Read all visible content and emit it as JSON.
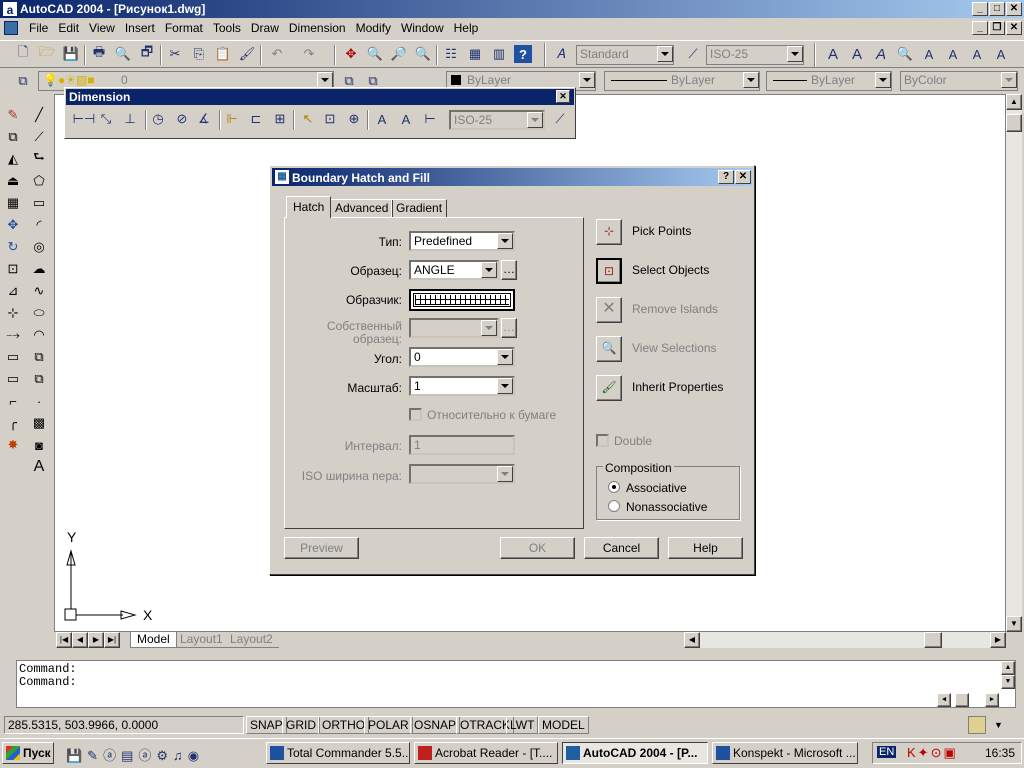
{
  "app": {
    "title": "AutoCAD 2004 - [Рисунок1.dwg]"
  },
  "menu": [
    "File",
    "Edit",
    "View",
    "Insert",
    "Format",
    "Tools",
    "Draw",
    "Dimension",
    "Modify",
    "Window",
    "Help"
  ],
  "toolbar": {
    "text_style": "Standard",
    "dim_style": "ISO-25"
  },
  "layers": {
    "current_layer": "0",
    "color": "ByLayer",
    "linetype": "ByLayer",
    "lineweight": "ByLayer",
    "plotstyle": "ByColor"
  },
  "dimension_toolbar": {
    "title": "Dimension",
    "style": "ISO-25"
  },
  "axes": {
    "y": "Y",
    "x": "X"
  },
  "layout_tabs": [
    "Model",
    "Layout1",
    "Layout2"
  ],
  "command": {
    "lines": [
      "Command:",
      "Command:"
    ]
  },
  "status": {
    "coords": "285.5315, 503.9966, 0.0000",
    "buttons": [
      "SNAP",
      "GRID",
      "ORTHO",
      "POLAR",
      "OSNAP",
      "OTRACK",
      "LWT",
      "MODEL"
    ]
  },
  "dialog": {
    "title": "Boundary Hatch and Fill",
    "tabs": [
      "Hatch",
      "Advanced",
      "Gradient"
    ],
    "fields": {
      "type_label": "Тип:",
      "type_value": "Predefined",
      "pattern_label": "Образец:",
      "pattern_value": "ANGLE",
      "swatch_label": "Образчик:",
      "custom_label_1": "Собственный",
      "custom_label_2": "образец:",
      "angle_label": "Угол:",
      "angle_value": "0",
      "scale_label": "Масштаб:",
      "scale_value": "1",
      "relative_label": "Относительно к бумаге",
      "spacing_label": "Интервал:",
      "spacing_value": "1",
      "iso_label": "ISO ширина пера:"
    },
    "actions": [
      "Pick Points",
      "Select Objects",
      "Remove Islands",
      "View Selections",
      "Inherit Properties"
    ],
    "double_label": "Double",
    "composition": {
      "title": "Composition",
      "associative": "Associative",
      "nonassociative": "Nonassociative"
    },
    "buttons": {
      "preview": "Preview",
      "ok": "OK",
      "cancel": "Cancel",
      "help": "Help"
    }
  },
  "taskbar": {
    "start": "Пуск",
    "tasks": [
      "Total Commander 5.5...",
      "Acrobat Reader - [T....",
      "AutoCAD 2004 - [P...",
      "Konspekt - Microsoft ..."
    ],
    "lang": "EN",
    "clock": "16:35"
  }
}
